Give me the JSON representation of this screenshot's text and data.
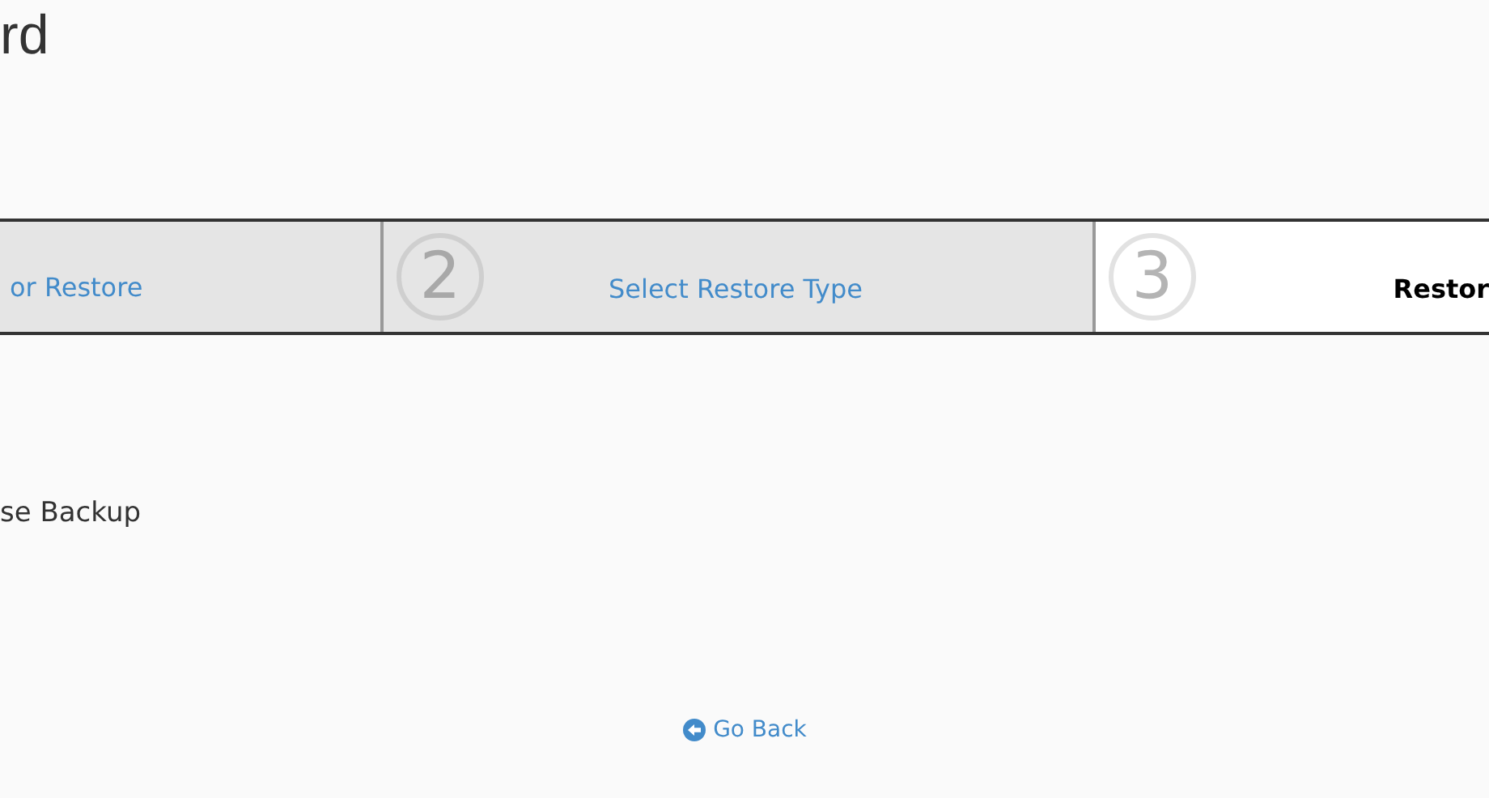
{
  "title": "rd",
  "steps": [
    {
      "label": "or Restore",
      "selected": false
    },
    {
      "number": "2",
      "label": "Select Restore Type",
      "selected": false
    },
    {
      "number": "3",
      "label": "Restor",
      "selected": true
    }
  ],
  "option_label": "se Backup",
  "back_link": "Go Back"
}
